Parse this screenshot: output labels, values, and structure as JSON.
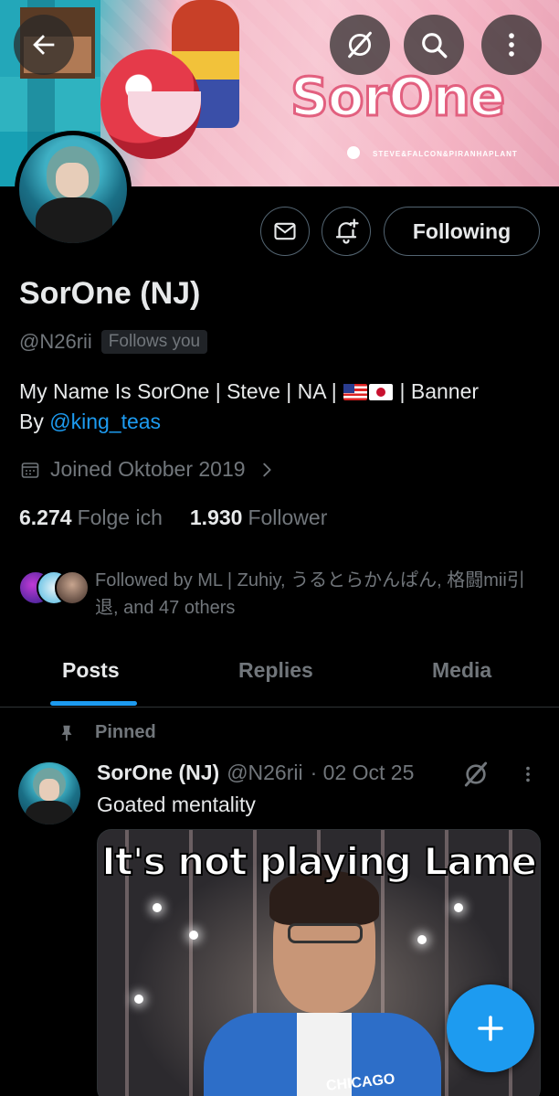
{
  "banner": {
    "brand_text": "SorOne",
    "brand_sub": "STEVE&FALCON&PIRANHAPLANT",
    "icons": {
      "back": "arrow-left-icon",
      "grok": "grok-icon",
      "search": "search-icon",
      "more": "more-vertical-icon"
    }
  },
  "profile": {
    "display_name": "SorOne (NJ)",
    "handle": "@N26rii",
    "follows_you": "Follows you",
    "bio_prefix": "My Name Is SorOne | Steve | NA | ",
    "bio_flags": "🇺🇸🇯🇵",
    "bio_suffix": " | Banner",
    "bio_by": "By ",
    "bio_link": "@king_teas",
    "joined": "Joined Oktober 2019",
    "following_count": "6.274",
    "following_label": "Folge ich",
    "followers_count": "1.930",
    "followers_label": "Follower",
    "followed_by": "Followed by ML | Zuhiy, うるとらかんぱん, 格闘mii引退, and 47 others"
  },
  "actions": {
    "message_icon": "envelope-icon",
    "notify_icon": "bell-plus-icon",
    "following_label": "Following"
  },
  "tabs": [
    {
      "label": "Posts",
      "active": true
    },
    {
      "label": "Replies",
      "active": false
    },
    {
      "label": "Media",
      "active": false
    }
  ],
  "pinned_post": {
    "pinned_label": "Pinned",
    "author_name": "SorOne (NJ)",
    "author_handle": "@N26rii",
    "date": "· 02 Oct 25",
    "text": "Goated mentality",
    "media_caption": "It's not playing Lame",
    "media_jacket_text": "CHICAGO"
  },
  "fab": {
    "icon": "plus-icon"
  },
  "colors": {
    "accent": "#1d9bf0",
    "background": "#000000",
    "text_primary": "#e7e9ea",
    "text_secondary": "#71767b",
    "border": "#2f3336"
  }
}
